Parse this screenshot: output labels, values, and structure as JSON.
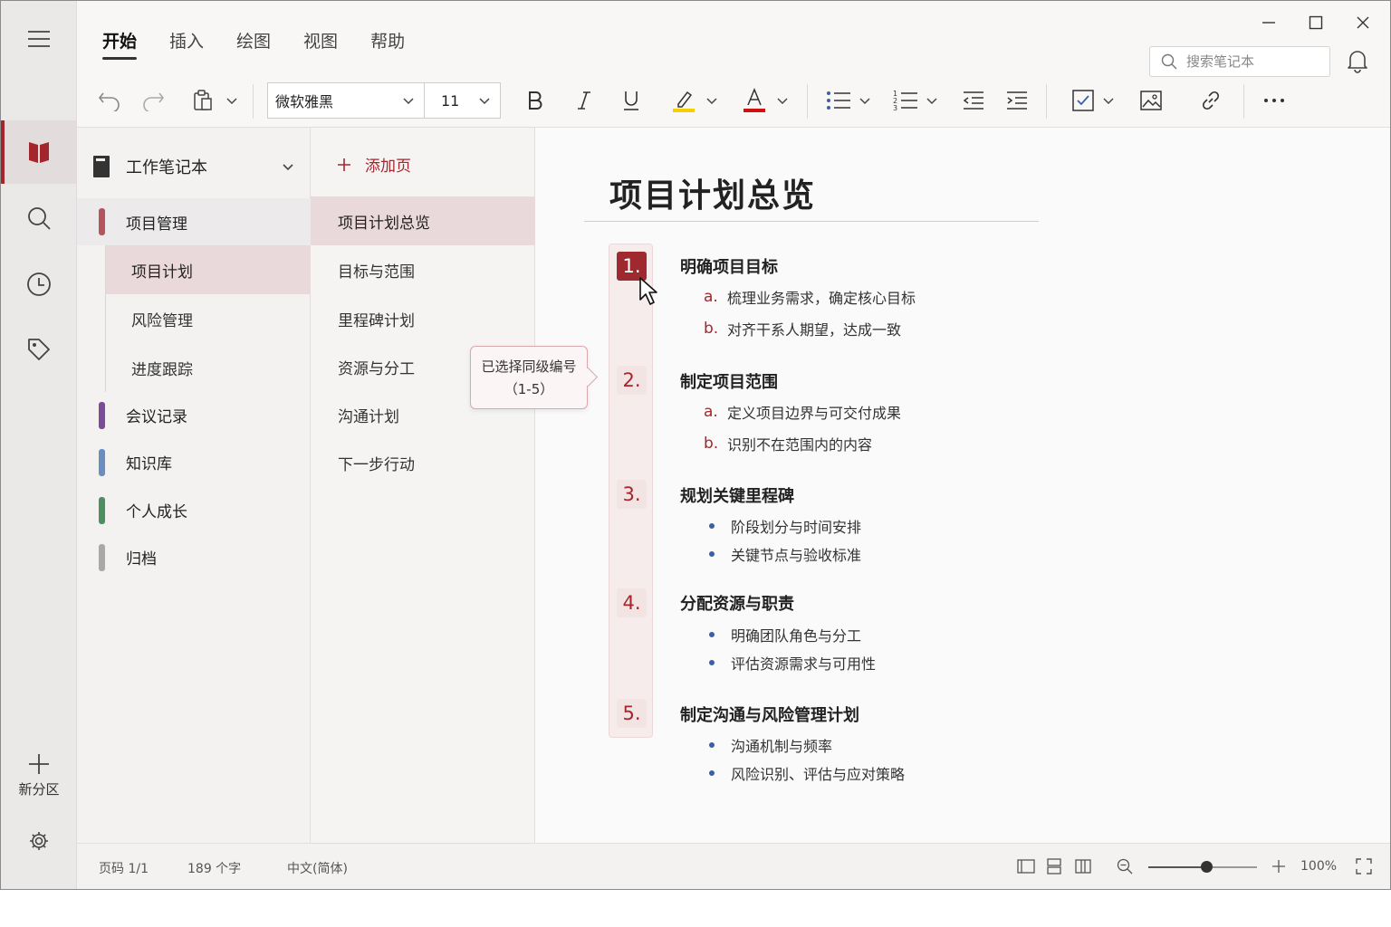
{
  "ribbon": {
    "tabs": [
      {
        "label": "开始",
        "active": true
      },
      {
        "label": "插入"
      },
      {
        "label": "绘图"
      },
      {
        "label": "视图"
      },
      {
        "label": "帮助"
      }
    ],
    "font_name": "微软雅黑",
    "font_size": "11",
    "search_placeholder": "搜索笔记本",
    "highlight_color": "#f5d000",
    "font_color": "#d01010"
  },
  "rail": {
    "new_section_label": "新分区"
  },
  "notebook": {
    "name": "工作笔记本",
    "sections": [
      {
        "label": "项目管理",
        "color": "#b4545c",
        "expanded": true,
        "subsections": [
          {
            "label": "项目计划",
            "active": true
          },
          {
            "label": "风险管理"
          },
          {
            "label": "进度跟踪"
          }
        ]
      },
      {
        "label": "会议记录",
        "color": "#7d4c99"
      },
      {
        "label": "知识库",
        "color": "#6a8fbf"
      },
      {
        "label": "个人成长",
        "color": "#4e8f62"
      },
      {
        "label": "归档",
        "color": "#a8a8a8"
      }
    ]
  },
  "pages": {
    "add_label": "添加页",
    "items": [
      {
        "label": "项目计划总览",
        "active": true
      },
      {
        "label": "目标与范围"
      },
      {
        "label": "里程碑计划"
      },
      {
        "label": "资源与分工"
      },
      {
        "label": "沟通计划"
      },
      {
        "label": "下一步行动"
      }
    ]
  },
  "tooltip": {
    "line1": "已选择同级编号",
    "line2": "（1-5）"
  },
  "document": {
    "title": "项目计划总览",
    "items": [
      {
        "num": "1.",
        "heading": "明确项目目标",
        "selected": true,
        "subs": [
          {
            "mark": "a.",
            "text": "梳理业务需求，确定核心目标"
          },
          {
            "mark": "b.",
            "text": "对齐干系人期望，达成一致"
          }
        ]
      },
      {
        "num": "2.",
        "heading": "制定项目范围",
        "subs": [
          {
            "mark": "a.",
            "text": "定义项目边界与可交付成果"
          },
          {
            "mark": "b.",
            "text": "识别不在范围内的内容"
          }
        ]
      },
      {
        "num": "3.",
        "heading": "规划关键里程碑",
        "subs": [
          {
            "mark": "•",
            "text": "阶段划分与时间安排"
          },
          {
            "mark": "•",
            "text": "关键节点与验收标准"
          }
        ]
      },
      {
        "num": "4.",
        "heading": "分配资源与职责",
        "subs": [
          {
            "mark": "•",
            "text": "明确团队角色与分工"
          },
          {
            "mark": "•",
            "text": "评估资源需求与可用性"
          }
        ]
      },
      {
        "num": "5.",
        "heading": "制定沟通与风险管理计划",
        "subs": [
          {
            "mark": "•",
            "text": "沟通机制与频率"
          },
          {
            "mark": "•",
            "text": "风险识别、评估与应对策略"
          }
        ]
      }
    ]
  },
  "status": {
    "page": "页码 1/1",
    "words": "189 个字",
    "language": "中文(简体)",
    "zoom": "100%",
    "zoom_fraction": 0.53
  },
  "accent_color": "#a4262c"
}
